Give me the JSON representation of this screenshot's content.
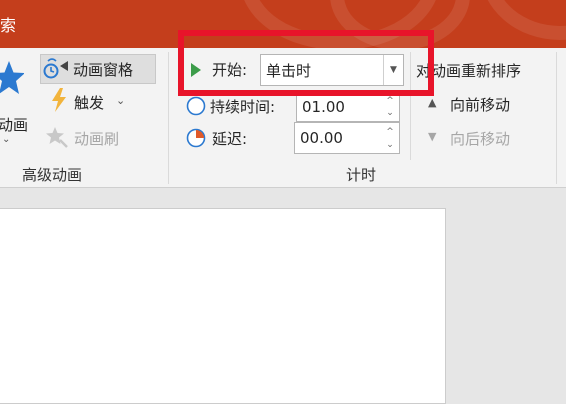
{
  "window": {
    "title_fragment": "索"
  },
  "ribbon": {
    "advanced_animation": {
      "add_animation_label": "动画",
      "animation_pane_label": "动画窗格",
      "trigger_label": "触发",
      "animation_painter_label": "动画刷",
      "group_label": "高级动画"
    },
    "timing": {
      "start_label": "开始:",
      "start_value": "单击时",
      "duration_label": "持续时间:",
      "duration_value": "01.00",
      "delay_label": "延迟:",
      "delay_value": "00.00",
      "group_label": "计时"
    },
    "reorder": {
      "title": "对动画重新排序",
      "move_earlier_label": "向前移动",
      "move_later_label": "向后移动"
    }
  },
  "colors": {
    "titlebar": "#c43e1c",
    "highlight_box": "#e8142a",
    "accent_blue": "#2b79d0",
    "start_triangle": "#3c9c4a"
  }
}
